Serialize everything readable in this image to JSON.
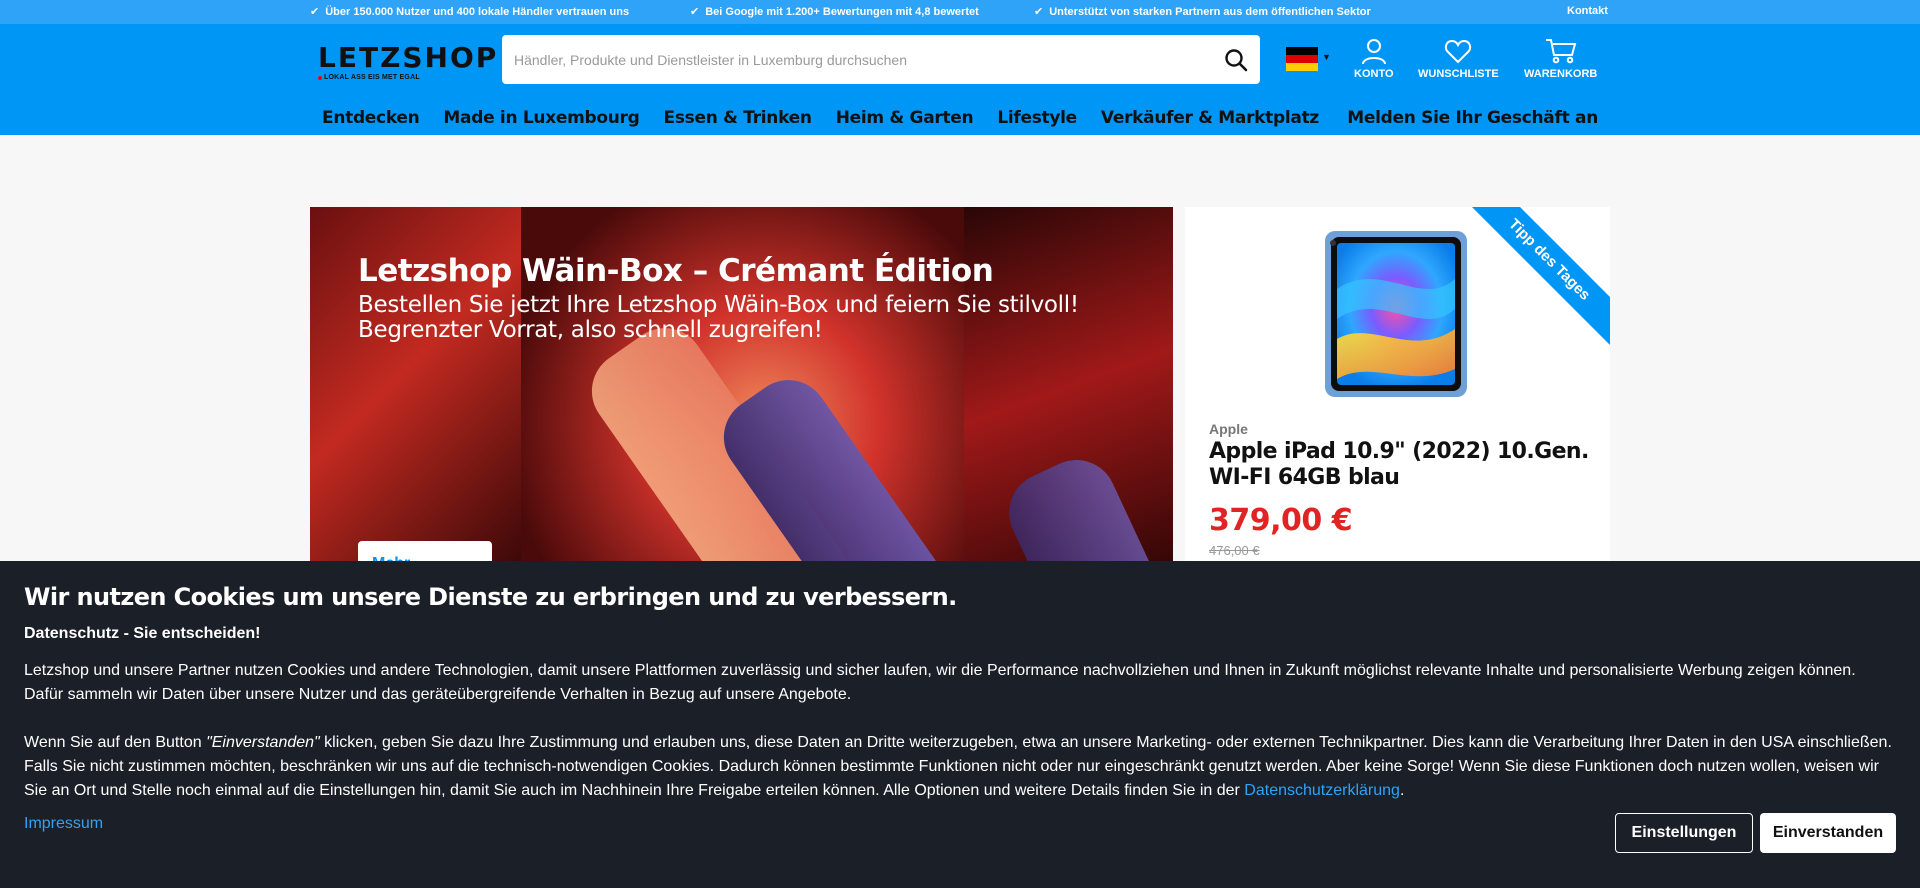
{
  "topbar": {
    "items": [
      "Über 150.000 Nutzer und 400 lokale Händler vertrauen uns",
      "Bei Google mit 1.200+ Bewertungen mit 4,8 bewertet",
      "Unterstützt von starken Partnern aus dem öffentlichen Sektor"
    ],
    "contact": "Kontakt"
  },
  "header": {
    "logo_word": "LETZSHOP",
    "logo_tag": "LOKAL ASS EIS MET EGAL",
    "search_placeholder": "Händler, Produkte und Dienstleister in Luxemburg durchsuchen",
    "account": "KONTO",
    "wishlist": "WUNSCHLISTE",
    "cart": "WARENKORB"
  },
  "nav": {
    "items": [
      "Entdecken",
      "Made in Luxembourg",
      "Essen & Trinken",
      "Heim & Garten",
      "Lifestyle",
      "Verkäufer & Marktplatz"
    ],
    "right": "Melden Sie Ihr Geschäft an"
  },
  "hero": {
    "title": "Letzshop Wäin-Box – Crémant Édition",
    "subtitle": "Bestellen Sie jetzt Ihre Letzshop Wäin-Box und feiern Sie stilvoll! Begrenzter Vorrat, also schnell zugreifen!",
    "button": "Mehr erfahren"
  },
  "deal": {
    "ribbon": "Tipp des Tages",
    "brand": "Apple",
    "name": "Apple iPad 10.9\" (2022) 10.Gen. WI-FI 64GB blau",
    "price": "379,00 €",
    "old_price": "476,00 €"
  },
  "cookie": {
    "title": "Wir nutzen Cookies um unsere Dienste zu erbringen und zu verbessern.",
    "subtitle": "Datenschutz - Sie entscheiden!",
    "p1": "Letzshop und unsere Partner nutzen Cookies und andere Technologien, damit unsere Plattformen zuverlässig und sicher laufen, wir die Performance nachvollziehen und Ihnen in Zukunft möglichst relevante Inhalte und personalisierte Werbung zeigen können. Dafür sammeln wir Daten über unsere Nutzer und das geräteübergreifende Verhalten in Bezug auf unsere Angebote.",
    "p2_a": "Wenn Sie auf den Button ",
    "p2_em": "\"Einverstanden\"",
    "p2_b": " klicken, geben Sie dazu Ihre Zustimmung und erlauben uns, diese Daten an Dritte weiterzugeben, etwa an unsere Marketing- oder externen Technikpartner. Dies kann die Verarbeitung Ihrer Daten in den USA einschließen. Falls Sie nicht zustimmen möchten, beschränken wir uns auf die technisch-notwendigen Cookies. Dadurch können bestimmte Funktionen nicht oder nur eingeschränkt genutzt werden. Aber keine Sorge! Wenn Sie diese Funktionen doch nutzen wollen, weisen wir Sie an Ort und Stelle noch einmal auf die Einstellungen hin, damit Sie auch im Nachhinein Ihre Freigabe erteilen können. Alle Optionen und weitere Details finden Sie in der ",
    "p2_link": "Datenschutzerklärung",
    "p2_end": ".",
    "impressum": "Impressum",
    "settings": "Einstellungen",
    "accept": "Einverstanden"
  },
  "colors": {
    "brand_blue": "#0096f6",
    "topbar_blue": "#2ea3f8",
    "price_red": "#e02424",
    "banner_bg": "#1b1f28"
  }
}
